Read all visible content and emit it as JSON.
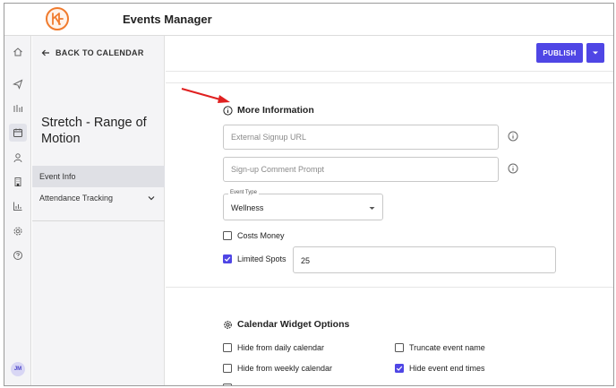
{
  "app": {
    "title": "Events Manager"
  },
  "colors": {
    "accent": "#4f46e5",
    "logo": "#f07b2e",
    "annotation_arrow": "#e02020"
  },
  "rail": {
    "icons": [
      "home-icon",
      "send-icon",
      "chart-icon",
      "calendar-icon",
      "user-icon",
      "building-icon",
      "bar-chart-icon",
      "gear-icon",
      "help-icon"
    ],
    "active": "calendar-icon",
    "avatar_initials": "JM"
  },
  "panel": {
    "back_label": "BACK TO CALENDAR",
    "event_title": "Stretch - Range of Motion",
    "nav_items": [
      {
        "label": "Event Info",
        "active": true
      },
      {
        "label": "Attendance Tracking",
        "active": false,
        "expandable": true
      }
    ]
  },
  "actions": {
    "publish_label": "PUBLISH"
  },
  "more_info": {
    "title": "More Information",
    "external_signup_placeholder": "External Signup URL",
    "comment_prompt_placeholder": "Sign-up Comment Prompt",
    "event_type": {
      "label": "Event Type",
      "value": "Wellness"
    },
    "costs_money": {
      "label": "Costs Money",
      "checked": false
    },
    "limited_spots": {
      "label": "Limited Spots",
      "checked": true,
      "value": "25"
    }
  },
  "widget_options": {
    "title": "Calendar Widget Options",
    "options": [
      {
        "label": "Hide from daily calendar",
        "checked": false
      },
      {
        "label": "Truncate event name",
        "checked": false
      },
      {
        "label": "Hide from weekly calendar",
        "checked": false
      },
      {
        "label": "Hide event end times",
        "checked": true
      }
    ]
  }
}
